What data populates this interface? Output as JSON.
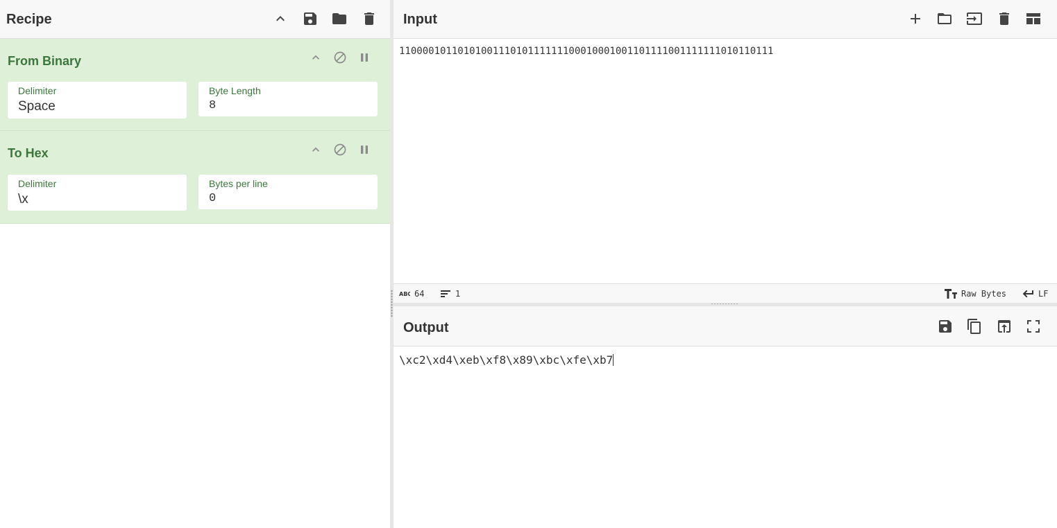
{
  "recipe": {
    "title": "Recipe",
    "operations": [
      {
        "name": "From Binary",
        "args": [
          {
            "label": "Delimiter",
            "value": "Space"
          },
          {
            "label": "Byte Length",
            "value": "8"
          }
        ]
      },
      {
        "name": "To Hex",
        "args": [
          {
            "label": "Delimiter",
            "value": "\\x"
          },
          {
            "label": "Bytes per line",
            "value": "0"
          }
        ]
      }
    ]
  },
  "input": {
    "title": "Input",
    "text": "1100001011010100111010111111100010001001101111001111111010110111",
    "status": {
      "char_count": "64",
      "line_count": "1",
      "encoding": "Raw Bytes",
      "eol": "LF"
    }
  },
  "output": {
    "title": "Output",
    "text": "\\xc2\\xd4\\xeb\\xf8\\x89\\xbc\\xfe\\xb7"
  },
  "icons": {
    "recipe_header": [
      "chevron-up-icon",
      "save-icon",
      "folder-icon",
      "trash-icon"
    ],
    "op_controls": [
      "chevron-up-icon",
      "disable-icon",
      "pause-icon"
    ],
    "input_header": [
      "plus-icon",
      "folder-icon",
      "input-file-icon",
      "trash-icon",
      "layout-icon"
    ],
    "output_header": [
      "save-icon",
      "copy-icon",
      "replace-input-icon",
      "maximize-icon"
    ]
  },
  "colors": {
    "operation_bg": "#dff0d8",
    "operation_text": "#3c763d",
    "header_bg": "#f8f8f8"
  }
}
